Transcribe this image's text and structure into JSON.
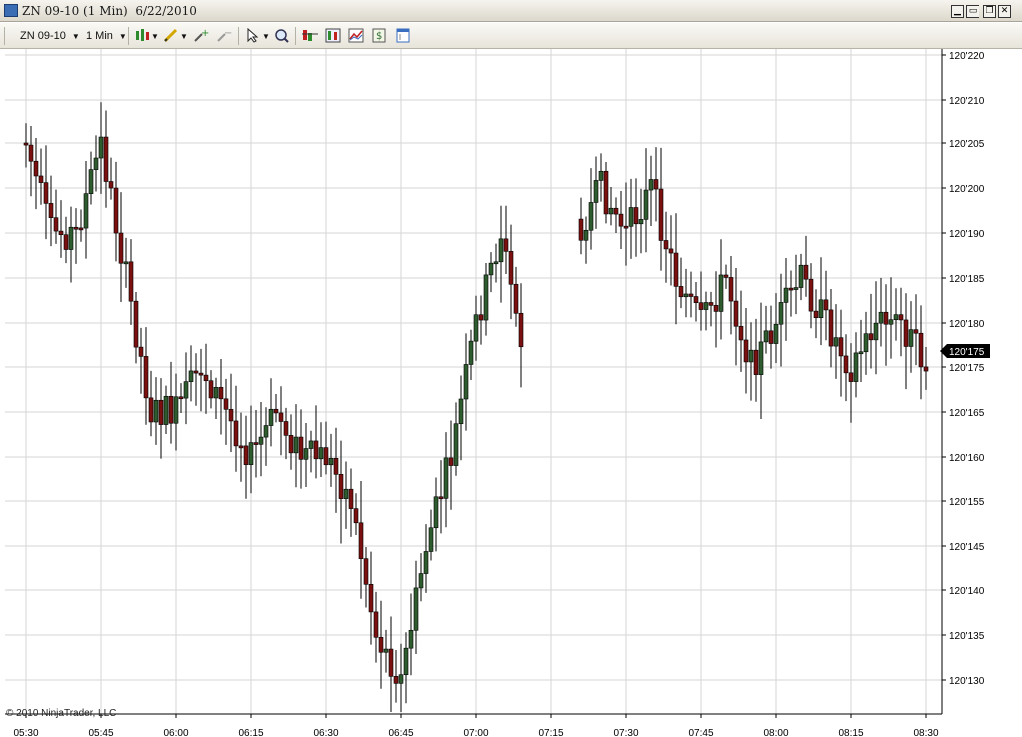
{
  "window": {
    "title": "ZN 09-10 (1 Min)  6/22/2010",
    "buttons": [
      "minimize",
      "restore",
      "close"
    ]
  },
  "toolbar": {
    "instrument": "ZN 09-10",
    "interval": "1 Min",
    "icons": [
      "chart-style-icon",
      "drawing-tools-icon",
      "zoom-in-icon",
      "zoom-out-icon",
      "cursor-icon",
      "data-box-icon",
      "indicators-icon",
      "strategies-icon",
      "chart-trader-icon",
      "properties-icon"
    ]
  },
  "copyright": "© 2010 NinjaTrader, LLC",
  "chart_data": {
    "type": "ohlc-bar",
    "instrument": "ZN 09-10",
    "bar_period": "1 Min",
    "date": "6/22/2010",
    "x_tick_labels": [
      "05:30",
      "05:45",
      "06:00",
      "06:15",
      "06:30",
      "06:45",
      "07:00",
      "07:15",
      "07:30",
      "07:45",
      "08:00",
      "08:15",
      "08:30"
    ],
    "y_tick_labels": [
      "120'220",
      "120'210",
      "120'205",
      "120'200",
      "120'190",
      "120'185",
      "120'180",
      "120'175",
      "120'165",
      "120'160",
      "120'155",
      "120'145",
      "120'140",
      "120'135",
      "120'130"
    ],
    "y_axis_note": "price in 32nds with half/quarter ticks; ticks labeled as shown",
    "last_price_label": "120'175",
    "colors": {
      "up_bar": "#2e5c2e",
      "down_bar": "#7a1010",
      "grid": "#d6d6d6",
      "price_marker_bg": "#000000",
      "price_marker_text": "#ffffff"
    },
    "grid": true,
    "series_approx_lows_highs_closes": {
      "description": "Approximate price path of ~185 one-minute bars read from the chart",
      "path_levels": [
        {
          "time": "05:30",
          "price_level": "120'205"
        },
        {
          "time": "05:35",
          "price_level": "120'190"
        },
        {
          "time": "05:40",
          "price_level": "120'190"
        },
        {
          "time": "05:45",
          "price_level": "120'205"
        },
        {
          "time": "05:50",
          "price_level": "120'185"
        },
        {
          "time": "05:55",
          "price_level": "120'165"
        },
        {
          "time": "06:00",
          "price_level": "120'165"
        },
        {
          "time": "06:05",
          "price_level": "120'175"
        },
        {
          "time": "06:10",
          "price_level": "120'165"
        },
        {
          "time": "06:15",
          "price_level": "120'160"
        },
        {
          "time": "06:20",
          "price_level": "120'165"
        },
        {
          "time": "06:25",
          "price_level": "120'160"
        },
        {
          "time": "06:30",
          "price_level": "120'160"
        },
        {
          "time": "06:35",
          "price_level": "120'155"
        },
        {
          "time": "06:40",
          "price_level": "120'135"
        },
        {
          "time": "06:45",
          "price_level": "120'130"
        },
        {
          "time": "06:50",
          "price_level": "120'145"
        },
        {
          "time": "06:55",
          "price_level": "120'160"
        },
        {
          "time": "07:00",
          "price_level": "120'180"
        },
        {
          "time": "07:05",
          "price_level": "120'190"
        },
        {
          "time": "07:10",
          "price_level": "120'175"
        },
        {
          "time": "07:15",
          "price_level": "120'170"
        },
        {
          "time": "07:20",
          "price_level": "120'190"
        },
        {
          "time": "07:25",
          "price_level": "120'200"
        },
        {
          "time": "07:30",
          "price_level": "120'190"
        },
        {
          "time": "07:35",
          "price_level": "120'200"
        },
        {
          "time": "07:40",
          "price_level": "120'185"
        },
        {
          "time": "07:45",
          "price_level": "120'180"
        },
        {
          "time": "07:50",
          "price_level": "120'185"
        },
        {
          "time": "07:55",
          "price_level": "120'175"
        },
        {
          "time": "08:00",
          "price_level": "120'180"
        },
        {
          "time": "08:05",
          "price_level": "120'185"
        },
        {
          "time": "08:10",
          "price_level": "120'180"
        },
        {
          "time": "08:15",
          "price_level": "120'175"
        },
        {
          "time": "08:20",
          "price_level": "120'180"
        },
        {
          "time": "08:25",
          "price_level": "120'180"
        },
        {
          "time": "08:30",
          "price_level": "120'175"
        }
      ]
    }
  }
}
